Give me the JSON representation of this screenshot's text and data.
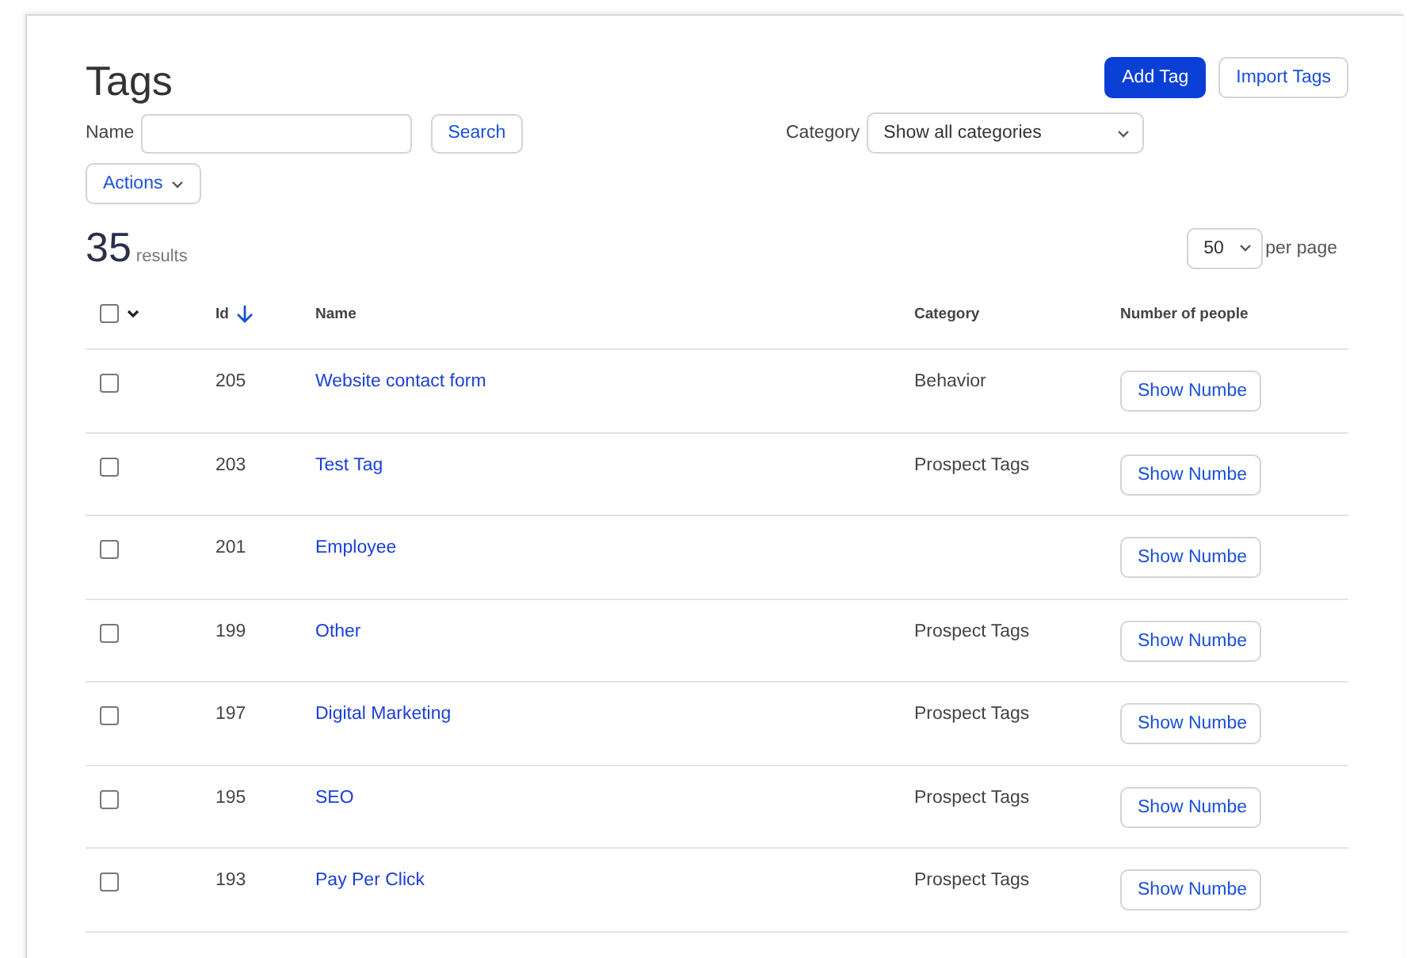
{
  "title": "Tags",
  "header_buttons": [
    {
      "label": "Add Tag",
      "kind": "primary"
    },
    {
      "label": "Import Tags",
      "kind": "secondary"
    }
  ],
  "filters": {
    "name_label": "Name",
    "search_button": "Search",
    "category_label": "Category",
    "category_value": "Show all categories"
  },
  "actions_button": "Actions",
  "results": {
    "count": "35",
    "label": "results"
  },
  "per_page": {
    "value": "50",
    "label": "per page"
  },
  "table": {
    "select_all_checked": false,
    "columns": [
      {
        "label": "Id",
        "sorted": true
      },
      {
        "label": "Name",
        "sorted": false
      },
      {
        "label": "Category",
        "sorted": false
      },
      {
        "label": "Number of people",
        "sorted": false
      }
    ],
    "rows": [
      {
        "checked": false,
        "id": "205",
        "name": "Website contact form",
        "category": "Behavior",
        "button": "Show Numbe"
      },
      {
        "checked": false,
        "id": "203",
        "name": "Test Tag",
        "category": "Prospect Tags",
        "button": "Show Numbe"
      },
      {
        "checked": false,
        "id": "201",
        "name": "Employee",
        "button": "Show Numbe"
      },
      {
        "checked": false,
        "id": "199",
        "name": "Other",
        "category": "Prospect Tags",
        "button": "Show Numbe"
      },
      {
        "checked": false,
        "id": "197",
        "name": "Digital Marketing",
        "category": "Prospect Tags",
        "button": "Show Numbe"
      },
      {
        "checked": false,
        "id": "195",
        "name": "SEO",
        "category": "Prospect Tags",
        "button": "Show Numbe"
      },
      {
        "checked": false,
        "id": "193",
        "name": "Pay Per Click",
        "category": "Prospect Tags",
        "button": "Show Numbe"
      }
    ]
  }
}
